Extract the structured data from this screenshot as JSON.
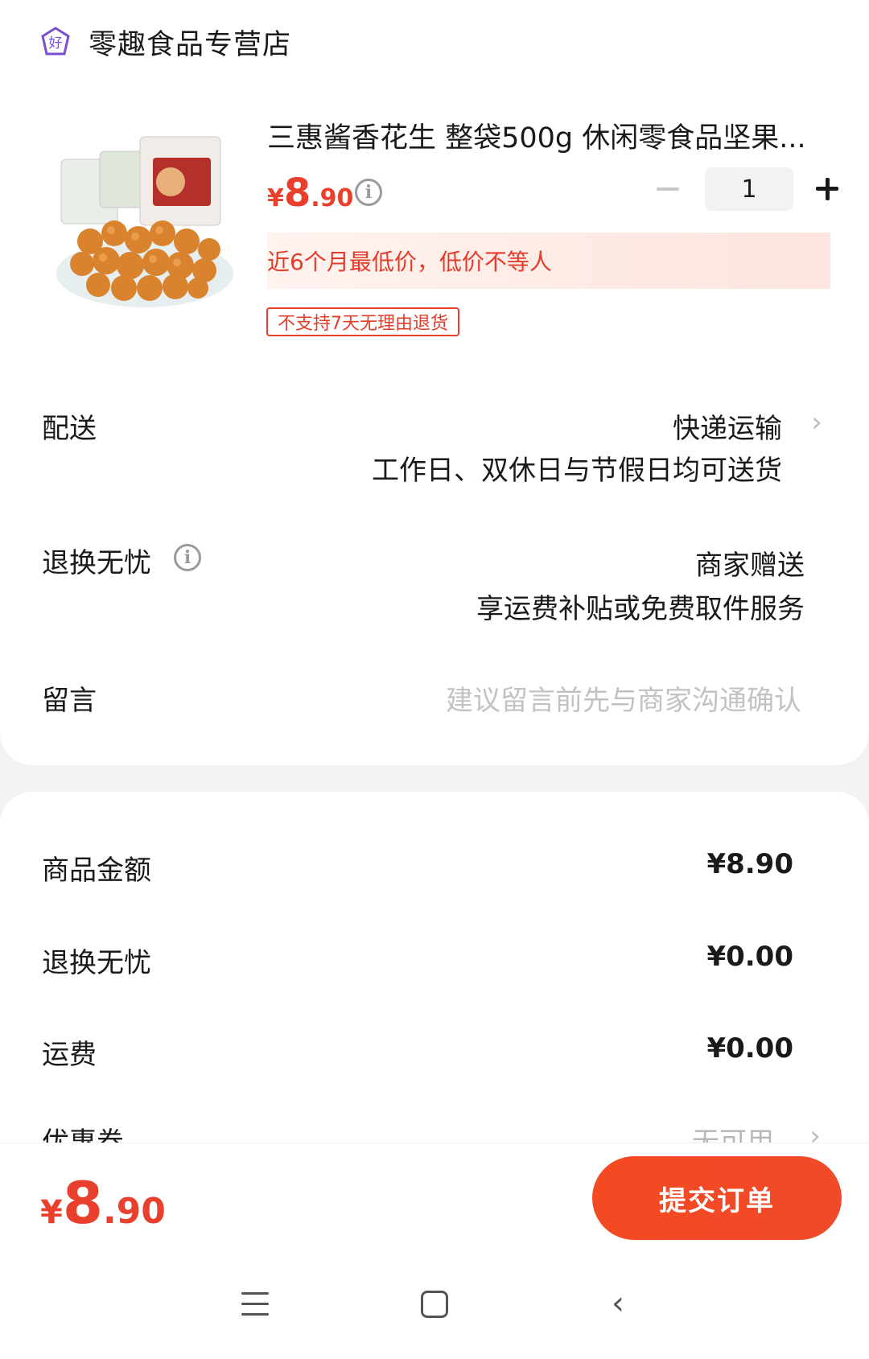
{
  "store": {
    "icon": "haodian-store-icon",
    "badge_char": "好",
    "name": "零趣食品专营店"
  },
  "product": {
    "title": "三惠酱香花生 整袋500g 休闲零食品坚果...",
    "price_symbol": "¥",
    "price_int": "8",
    "price_dec": ".90",
    "quantity": "1",
    "lowprice_note": "近6个月最低价，低价不等人",
    "return_tag": "不支持7天无理由退货",
    "colors": {
      "accent": "#e8402d"
    }
  },
  "delivery": {
    "label": "配送",
    "method": "快递运输",
    "detail": "工作日、双休日与节假日均可送货"
  },
  "return_service": {
    "label": "退换无忧",
    "value": "商家赠送",
    "detail": "享运费补贴或免费取件服务"
  },
  "message": {
    "label": "留言",
    "placeholder": "建议留言前先与商家沟通确认"
  },
  "fees": {
    "goods_label": "商品金额",
    "goods_value": "¥8.90",
    "return_label": "退换无忧",
    "return_value": "¥0.00",
    "shipping_label": "运费",
    "shipping_value": "¥0.00",
    "coupon_label": "优惠券",
    "coupon_value": "无可用"
  },
  "footer": {
    "total_symbol": "¥",
    "total_int": "8",
    "total_dec": ".90",
    "submit_label": "提交订单"
  },
  "nav": {
    "icons": [
      "menu-icon",
      "home-icon",
      "back-icon"
    ]
  }
}
